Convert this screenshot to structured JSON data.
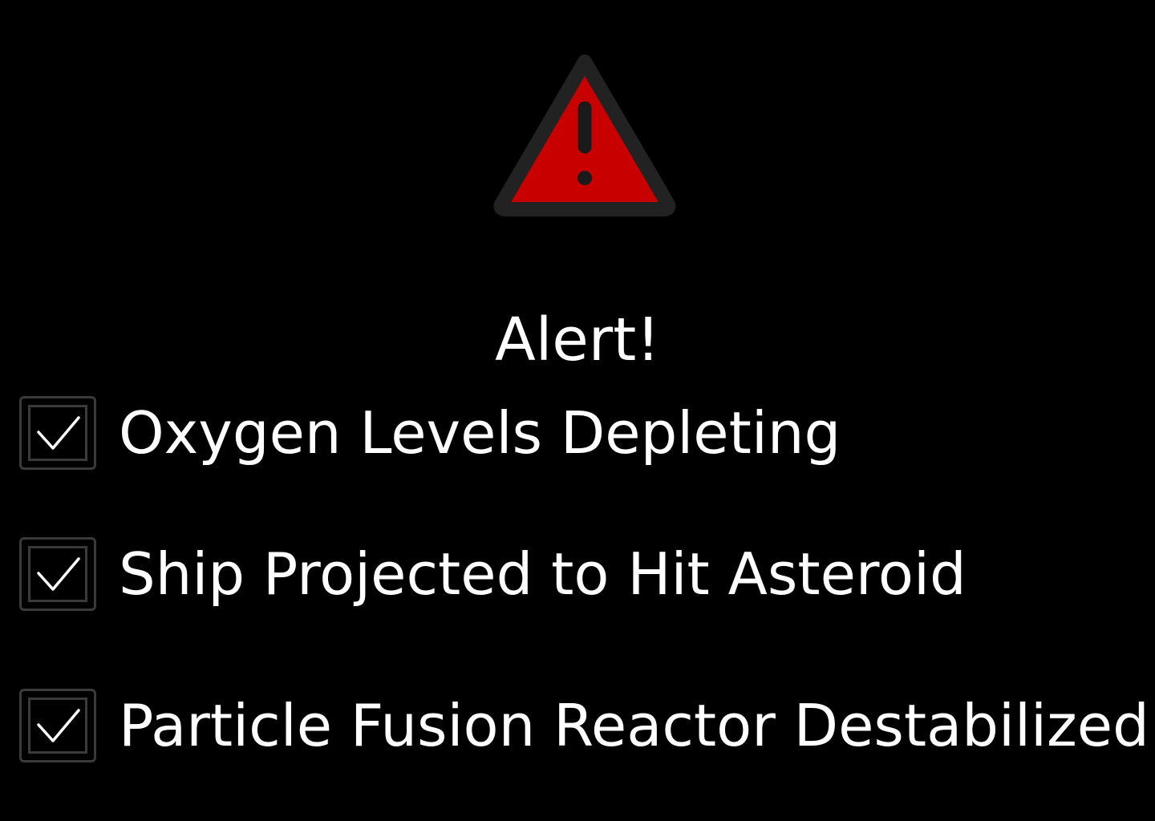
{
  "colors": {
    "background": "#000000",
    "warning_fill": "#c80000",
    "warning_outline": "#222222",
    "warning_mark": "#1a1a1a",
    "text": "#ffffff",
    "checkbox_border": "#3a3a3a",
    "checkmark": "#ffffff"
  },
  "icons": {
    "warning": "warning-triangle-icon",
    "check": "checkmark-icon"
  },
  "alert": {
    "title": "Alert!",
    "items": [
      {
        "label": "Oxygen Levels Depleting",
        "checked": true
      },
      {
        "label": "Ship Projected to Hit Asteroid",
        "checked": true
      },
      {
        "label": "Particle Fusion Reactor Destabilized",
        "checked": true
      }
    ]
  }
}
